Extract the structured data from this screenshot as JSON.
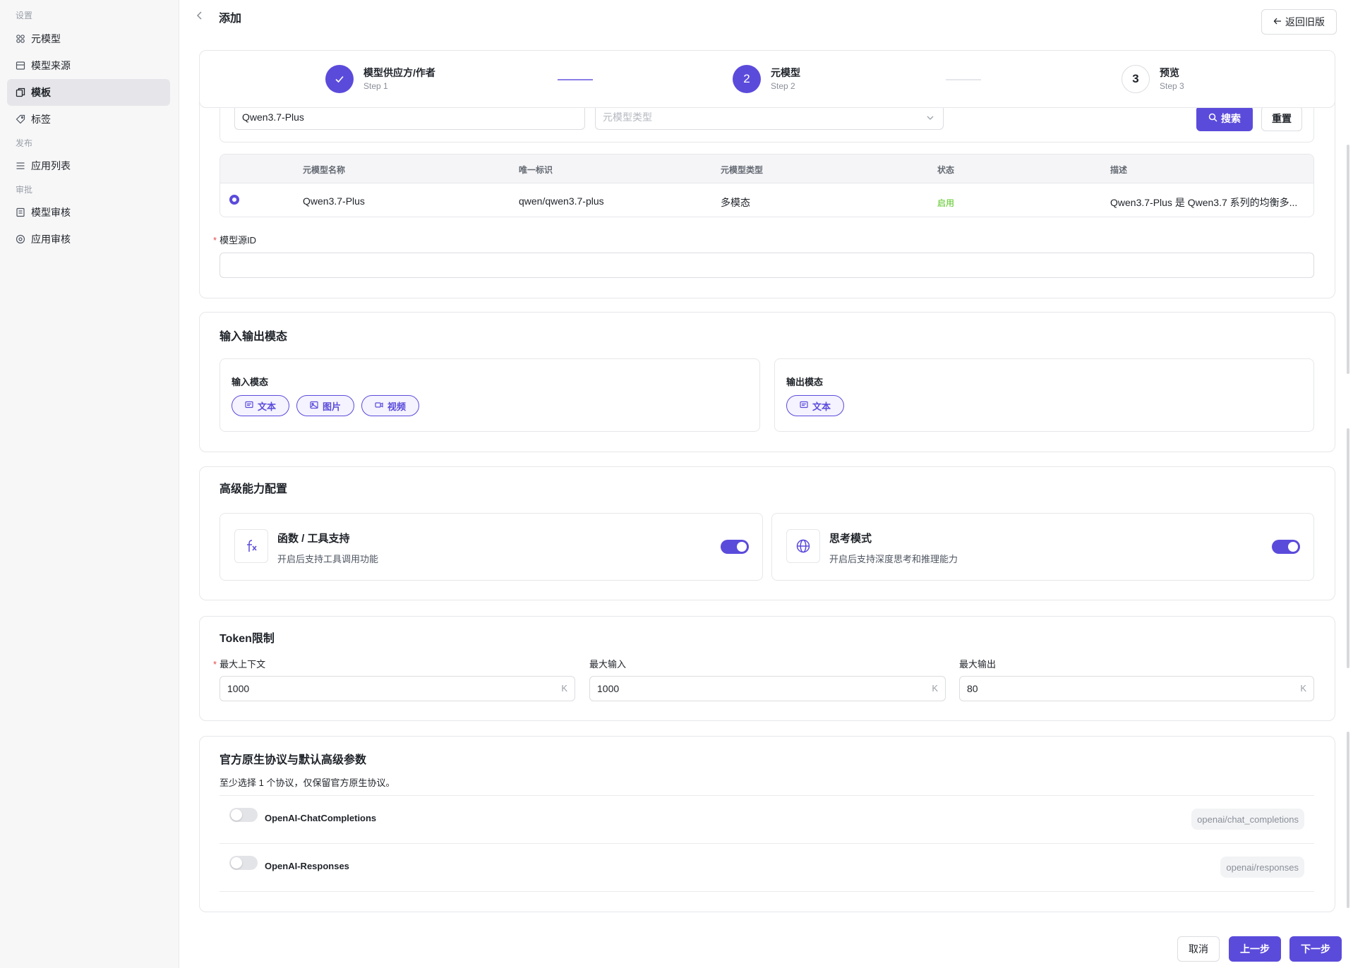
{
  "sidebar": {
    "groups": {
      "settings": "设置",
      "publish": "发布",
      "review": "审批"
    },
    "items": [
      {
        "label": "元模型",
        "icon": "meta-model-icon"
      },
      {
        "label": "模型来源",
        "icon": "source-icon"
      },
      {
        "label": "模板",
        "icon": "template-icon"
      },
      {
        "label": "标签",
        "icon": "tag-icon"
      },
      {
        "label": "应用列表",
        "icon": "list-icon"
      },
      {
        "label": "模型审核",
        "icon": "model-review-icon"
      },
      {
        "label": "应用审核",
        "icon": "app-review-icon"
      }
    ],
    "active": "模板"
  },
  "header": {
    "title": "添加",
    "old_version_button": "返回旧版"
  },
  "steps": [
    {
      "num": "1",
      "title": "模型供应方/作者",
      "sub": "Step 1",
      "state": "done"
    },
    {
      "num": "2",
      "title": "元模型",
      "sub": "Step 2",
      "state": "current"
    },
    {
      "num": "3",
      "title": "预览",
      "sub": "Step 3",
      "state": "todo"
    }
  ],
  "filter": {
    "name_value": "Qwen3.7-Plus",
    "type_placeholder": "元模型类型",
    "search_button": "搜索",
    "reset_button": "重置"
  },
  "table": {
    "headers": {
      "name": "元模型名称",
      "id": "唯一标识",
      "type": "元模型类型",
      "status": "状态",
      "desc": "描述"
    },
    "row": {
      "name": "Qwen3.7-Plus",
      "id": "qwen/qwen3.7-plus",
      "type": "多模态",
      "status": "启用",
      "desc": "Qwen3.7-Plus 是 Qwen3.7 系列的均衡多..."
    }
  },
  "model_source_id": {
    "label": "模型源ID",
    "value": ""
  },
  "io": {
    "title": "输入输出模态",
    "input_title": "输入模态",
    "input_chips": [
      "文本",
      "图片",
      "视频"
    ],
    "output_title": "输出模态",
    "output_chips": [
      "文本"
    ]
  },
  "advanced": {
    "title": "高级能力配置",
    "function": {
      "title": "函数 / 工具支持",
      "desc": "开启后支持工具调用功能",
      "enabled": true
    },
    "thinking": {
      "title": "思考模式",
      "desc": "开启后支持深度思考和推理能力",
      "enabled": true
    }
  },
  "token": {
    "title": "Token限制",
    "max_context": {
      "label": "最大上下文",
      "value": "1000",
      "unit": "K"
    },
    "max_input": {
      "label": "最大输入",
      "value": "1000",
      "unit": "K"
    },
    "max_output": {
      "label": "最大输出",
      "value": "80",
      "unit": "K"
    }
  },
  "protocol": {
    "title": "官方原生协议与默认高级参数",
    "hint": "至少选择 1 个协议，仅保留官方原生协议。",
    "items": [
      {
        "name": "OpenAI-ChatCompletions",
        "tag": "openai/chat_completions",
        "enabled": false
      },
      {
        "name": "OpenAI-Responses",
        "tag": "openai/responses",
        "enabled": false
      }
    ]
  },
  "footer": {
    "cancel": "取消",
    "prev": "上一步",
    "next": "下一步"
  },
  "colors": {
    "accent": "#5b4bdb",
    "success": "#52c41a"
  }
}
